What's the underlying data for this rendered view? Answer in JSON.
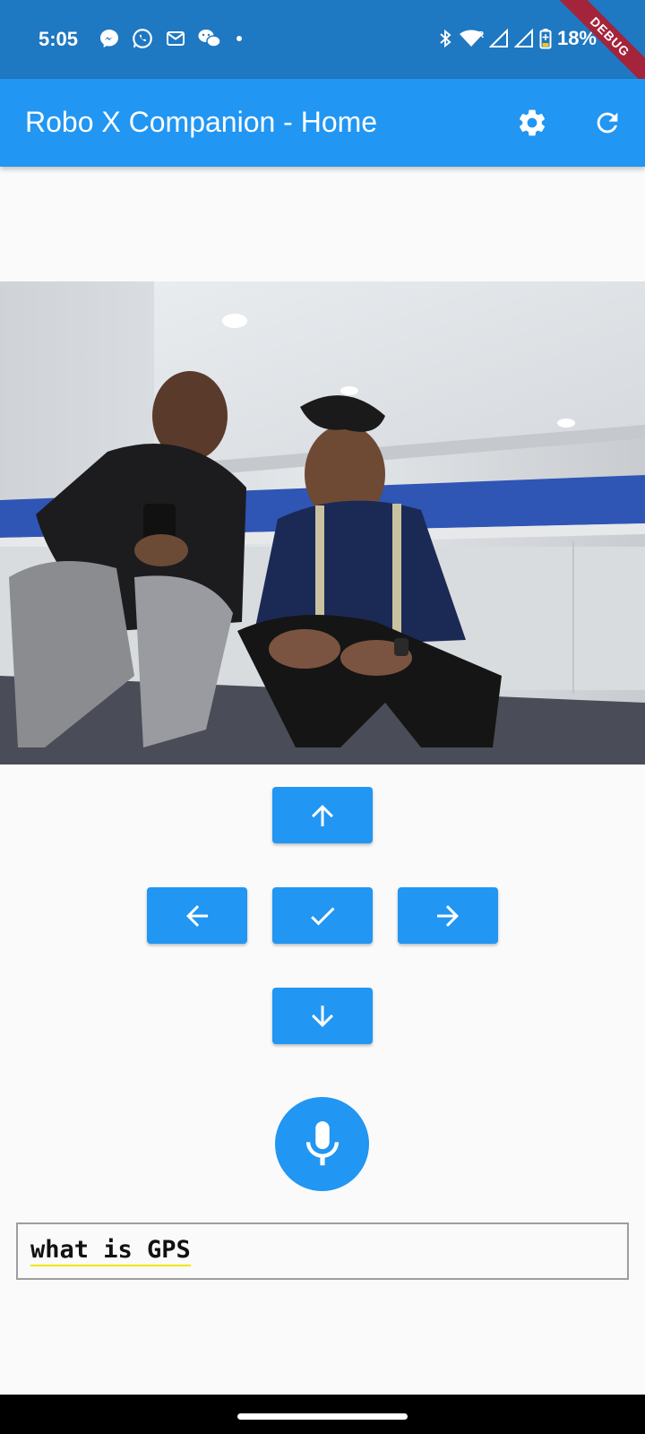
{
  "status_bar": {
    "time": "5:05",
    "battery": "18%",
    "left_icons": [
      "messenger-icon",
      "whatsapp-icon",
      "gmail-icon",
      "wechat-icon",
      "more-dot-icon"
    ],
    "right_icons": [
      "bluetooth-icon",
      "wifi-icon",
      "signal-r-icon",
      "signal-icon",
      "battery-icon"
    ]
  },
  "debug_banner": "DEBUG",
  "app_bar": {
    "title": "Robo X Companion - Home",
    "actions": [
      "settings-icon",
      "refresh-icon"
    ]
  },
  "controls": {
    "up": "arrow-up-icon",
    "left": "arrow-left-icon",
    "ok": "check-icon",
    "right": "arrow-right-icon",
    "down": "arrow-down-icon",
    "mic": "microphone-icon"
  },
  "speech_input": {
    "value": "what is GPS"
  },
  "colors": {
    "status_bar": "#1e78c2",
    "primary": "#2196f3",
    "background": "#fafafa",
    "debug_ribbon": "#a3243b"
  }
}
